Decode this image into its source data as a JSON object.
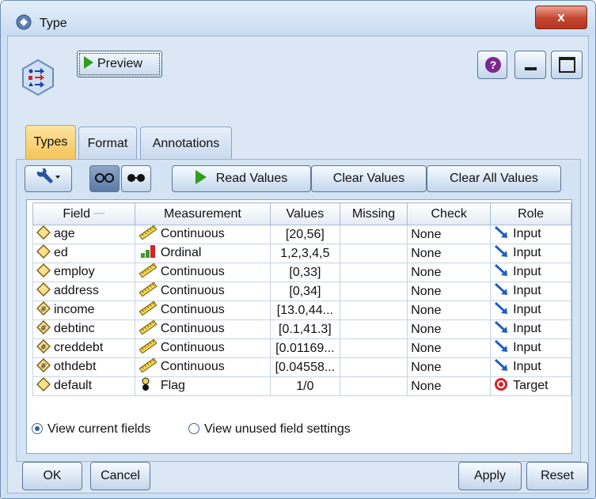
{
  "window": {
    "title": "Type",
    "close_label": "x"
  },
  "header": {
    "preview_label": "Preview",
    "help_label": "?"
  },
  "tabs": [
    {
      "label": "Types",
      "active": true
    },
    {
      "label": "Format",
      "active": false
    },
    {
      "label": "Annotations",
      "active": false
    }
  ],
  "toolbar": {
    "read_values": "Read Values",
    "clear_values": "Clear Values",
    "clear_all_values": "Clear All Values"
  },
  "table": {
    "columns": [
      "Field",
      "Measurement",
      "Values",
      "Missing",
      "Check",
      "Role"
    ],
    "rows": [
      {
        "field": "age",
        "field_icon": "diamond-icon",
        "measurement": "Continuous",
        "meas_icon": "ruler-icon",
        "values": "[20,56]",
        "missing": "",
        "check": "None",
        "role": "Input",
        "role_icon": "input-arrow-icon"
      },
      {
        "field": "ed",
        "field_icon": "diamond-icon",
        "measurement": "Ordinal",
        "meas_icon": "bar-chart-icon",
        "values": "1,2,3,4,5",
        "missing": "",
        "check": "None",
        "role": "Input",
        "role_icon": "input-arrow-icon"
      },
      {
        "field": "employ",
        "field_icon": "diamond-icon",
        "measurement": "Continuous",
        "meas_icon": "ruler-icon",
        "values": "[0,33]",
        "missing": "",
        "check": "None",
        "role": "Input",
        "role_icon": "input-arrow-icon"
      },
      {
        "field": "address",
        "field_icon": "diamond-icon",
        "measurement": "Continuous",
        "meas_icon": "ruler-icon",
        "values": "[0,34]",
        "missing": "",
        "check": "None",
        "role": "Input",
        "role_icon": "input-arrow-icon"
      },
      {
        "field": "income",
        "field_icon": "hash-diamond-icon",
        "measurement": "Continuous",
        "meas_icon": "ruler-icon",
        "values": "[13.0,44...",
        "missing": "",
        "check": "None",
        "role": "Input",
        "role_icon": "input-arrow-icon"
      },
      {
        "field": "debtinc",
        "field_icon": "hash-diamond-icon",
        "measurement": "Continuous",
        "meas_icon": "ruler-icon",
        "values": "[0.1,41.3]",
        "missing": "",
        "check": "None",
        "role": "Input",
        "role_icon": "input-arrow-icon"
      },
      {
        "field": "creddebt",
        "field_icon": "hash-diamond-icon",
        "measurement": "Continuous",
        "meas_icon": "ruler-icon",
        "values": "[0.01169...",
        "missing": "",
        "check": "None",
        "role": "Input",
        "role_icon": "input-arrow-icon"
      },
      {
        "field": "othdebt",
        "field_icon": "hash-diamond-icon",
        "measurement": "Continuous",
        "meas_icon": "ruler-icon",
        "values": "[0.04558...",
        "missing": "",
        "check": "None",
        "role": "Input",
        "role_icon": "input-arrow-icon"
      },
      {
        "field": "default",
        "field_icon": "diamond-icon",
        "measurement": "Flag",
        "meas_icon": "flag-icon",
        "values": "1/0",
        "missing": "",
        "check": "None",
        "role": "Target",
        "role_icon": "target-icon"
      }
    ]
  },
  "view_options": {
    "current": "View current fields",
    "unused": "View unused field settings",
    "selected": "current"
  },
  "buttons": {
    "ok": "OK",
    "cancel": "Cancel",
    "apply": "Apply",
    "reset": "Reset"
  },
  "colors": {
    "accent_tab": "#f4c457",
    "window_bg": "#dbe7f5",
    "close_red": "#c5452f",
    "input_arrow": "#1f5fbf",
    "target_red": "#d3232a"
  }
}
